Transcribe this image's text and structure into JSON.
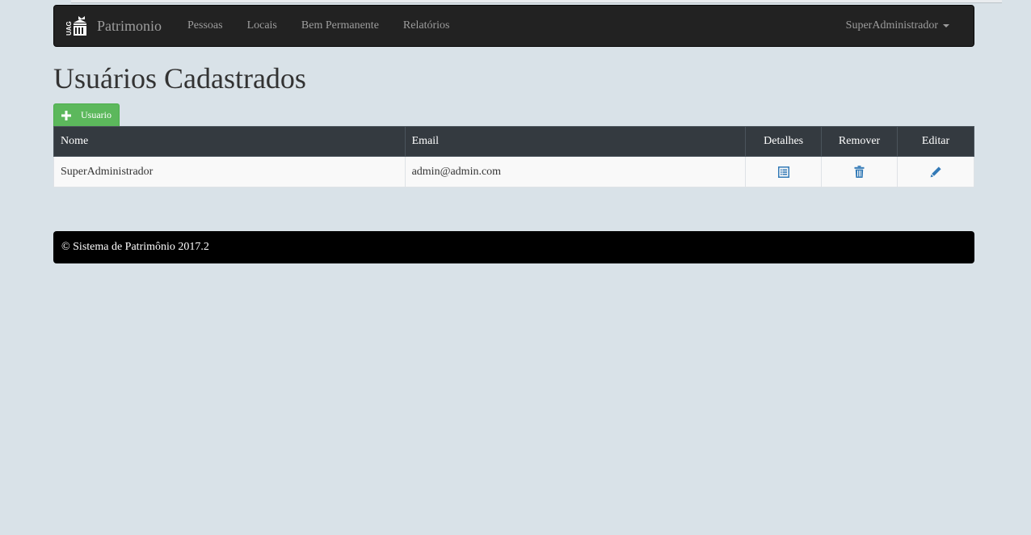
{
  "navbar": {
    "brand": "Patrimonio",
    "logo_text": "UAG",
    "links": [
      "Pessoas",
      "Locais",
      "Bem Permanente",
      "Relatórios"
    ],
    "user": "SuperAdministrador"
  },
  "page": {
    "title": "Usuários Cadastrados",
    "add_button_label": "Usuario"
  },
  "table": {
    "headers": [
      "Nome",
      "Email",
      "Detalhes",
      "Remover",
      "Editar"
    ],
    "rows": [
      {
        "nome": "SuperAdministrador",
        "email": "admin@admin.com"
      }
    ]
  },
  "footer": {
    "text": "© Sistema de Patrimônio 2017.2"
  },
  "colors": {
    "navbar_bg": "#222222",
    "page_bg": "#d9e2e8",
    "success_green": "#5cb85c",
    "table_header_bg": "#343a40",
    "action_icon_blue": "#337ab7",
    "footer_bg": "#000000"
  },
  "icons": {
    "brand": "building-logo-icon",
    "add": "plus-icon",
    "details": "list-alt-icon",
    "remove": "trash-icon",
    "edit": "pencil-icon",
    "user_menu": "caret-down-icon"
  }
}
